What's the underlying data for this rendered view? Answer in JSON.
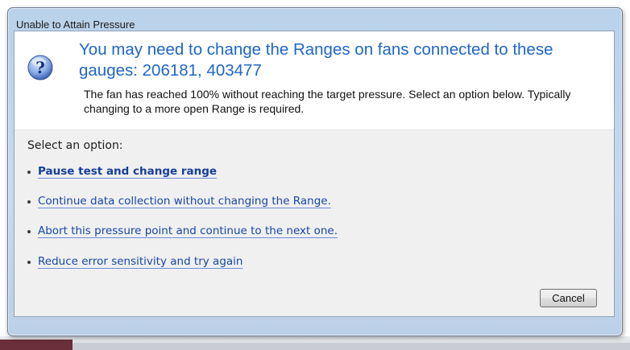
{
  "dialog": {
    "title": "Unable to Attain Pressure",
    "heading": "You may need to change the Ranges on fans connected to these gauges: 206181, 403477",
    "message": "The fan has reached 100% without reaching the target pressure. Select an option below. Typically changing to a more open Range is required.",
    "prompt": "Select an option:",
    "options": [
      {
        "label": "Pause test and change range",
        "bold": true
      },
      {
        "label": "Continue data collection without changing the Range.",
        "bold": false
      },
      {
        "label": "Abort this pressure point and continue to the next one.",
        "bold": false
      },
      {
        "label": "Reduce error sensitivity and try again",
        "bold": false
      }
    ],
    "cancel_label": "Cancel",
    "icon": "question-icon"
  },
  "colors": {
    "heading": "#2066c8",
    "link": "#1846a6",
    "frame": "#c7d9ee"
  }
}
